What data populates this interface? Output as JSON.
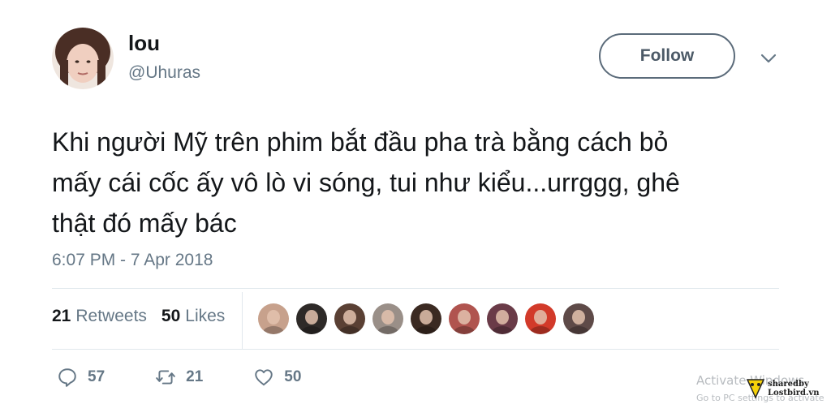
{
  "user": {
    "name": "lou",
    "handle": "@Uhuras"
  },
  "follow_button": {
    "label": "Follow"
  },
  "tweet": {
    "text_lines": [
      "Khi người Mỹ trên phim bắt đầu pha trà bằng cách bỏ",
      "mấy cái cốc ấy vô lò vi sóng, tui như kiểu...urrggg, ghê",
      "thật đó mấy bác"
    ],
    "timestamp": "6:07 PM - 7 Apr 2018"
  },
  "stats": {
    "retweets_count": "21",
    "retweets_label": "Retweets",
    "likes_count": "50",
    "likes_label": "Likes"
  },
  "liked_by_avatars": [
    {
      "name": "liker-avatar-1",
      "color": "#c7a18c"
    },
    {
      "name": "liker-avatar-2",
      "color": "#2e2a28"
    },
    {
      "name": "liker-avatar-3",
      "color": "#5a4034"
    },
    {
      "name": "liker-avatar-4",
      "color": "#9a8f88"
    },
    {
      "name": "liker-avatar-5",
      "color": "#3b2a22"
    },
    {
      "name": "liker-avatar-6",
      "color": "#b0544f"
    },
    {
      "name": "liker-avatar-7",
      "color": "#6a3b48"
    },
    {
      "name": "liker-avatar-8",
      "color": "#d23a2a"
    },
    {
      "name": "liker-avatar-9",
      "color": "#5e4a48"
    }
  ],
  "actions": {
    "reply_count": "57",
    "retweet_count": "21",
    "like_count": "50"
  },
  "watermark": {
    "line1": "Activate Windows",
    "line2": "Go to PC settings to activate",
    "badge_line1": "sharedby",
    "badge_line2": "Lostbird.vn"
  },
  "colors": {
    "text_primary": "#14171a",
    "text_secondary": "#657786",
    "divider": "#e1e8ed"
  }
}
